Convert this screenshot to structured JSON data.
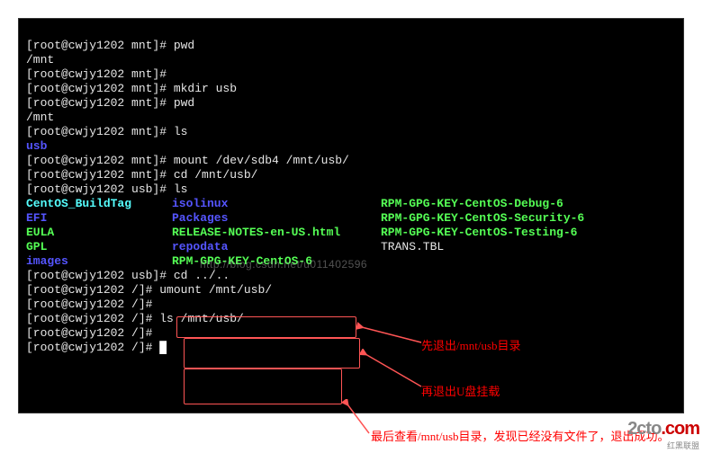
{
  "prompt_mnt": "[root@cwjy1202 mnt]# ",
  "prompt_usb": "[root@cwjy1202 usb]# ",
  "prompt_root": "[root@cwjy1202 /]# ",
  "cmds": {
    "pwd": "pwd",
    "mkdir": "mkdir usb",
    "ls": "ls",
    "mount": "mount /dev/sdb4 /mnt/usb/",
    "cd_usb": "cd /mnt/usb/",
    "cd_up": "cd ../..",
    "umount": "umount /mnt/usb/",
    "ls_usb": "ls /mnt/usb/"
  },
  "outputs": {
    "mnt": "/mnt",
    "usb": "usb"
  },
  "listing": {
    "row1": {
      "c1": "CentOS_BuildTag",
      "c2": "isolinux",
      "c3": "RPM-GPG-KEY-CentOS-Debug-6"
    },
    "row2": {
      "c1": "EFI",
      "c2": "Packages",
      "c3": "RPM-GPG-KEY-CentOS-Security-6"
    },
    "row3": {
      "c1": "EULA",
      "c2": "RELEASE-NOTES-en-US.html",
      "c3": "RPM-GPG-KEY-CentOS-Testing-6"
    },
    "row4": {
      "c1": "GPL",
      "c2": "repodata",
      "c3": "TRANS.TBL"
    },
    "row5": {
      "c1": "images",
      "c2": "RPM-GPG-KEY-CentOS-6"
    }
  },
  "annotations": {
    "a1": "先退出/mnt/usb目录",
    "a2": "再退出U盘挂载",
    "a3": "最后查看/mnt/usb目录，发现已经没有文件了，退出成功。"
  },
  "watermark": "http://blog.csdn.net/u011402596",
  "logo": {
    "name": "2cto",
    "suffix": ".com",
    "sub": "红黑联盟"
  }
}
